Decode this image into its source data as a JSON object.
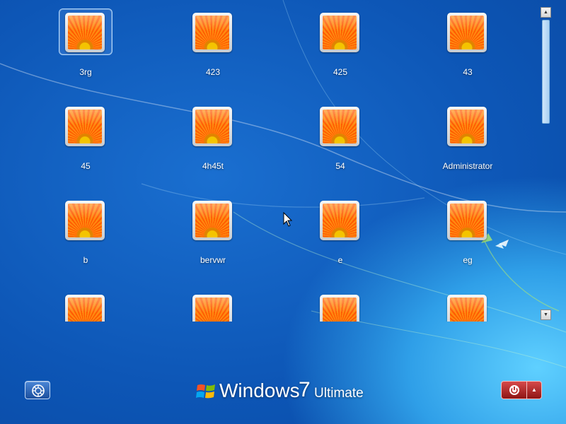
{
  "users": [
    {
      "name": "3rg",
      "selected": true
    },
    {
      "name": "423"
    },
    {
      "name": "425"
    },
    {
      "name": "43"
    },
    {
      "name": "45"
    },
    {
      "name": "4h45t"
    },
    {
      "name": "54"
    },
    {
      "name": "Administrator"
    },
    {
      "name": "b"
    },
    {
      "name": "bervwr"
    },
    {
      "name": "e"
    },
    {
      "name": "eg"
    },
    {
      "name": ""
    },
    {
      "name": ""
    },
    {
      "name": ""
    },
    {
      "name": ""
    }
  ],
  "branding": {
    "windows": "Windows",
    "version": "7",
    "edition": "Ultimate"
  },
  "icons": {
    "ease_of_access": "ease-of-access-icon",
    "power": "power-icon",
    "power_options": "chevron-up-icon",
    "scroll_up": "chevron-up-icon",
    "scroll_down": "chevron-down-icon",
    "user_picture": "flower-user-picture",
    "windows_logo": "windows-flag-logo"
  },
  "colors": {
    "background": "#0d56b6",
    "power_button": "#b52222",
    "text": "#ffffff"
  },
  "scroll": {
    "thumb_fraction": 0.36,
    "position_fraction": 0.0
  }
}
